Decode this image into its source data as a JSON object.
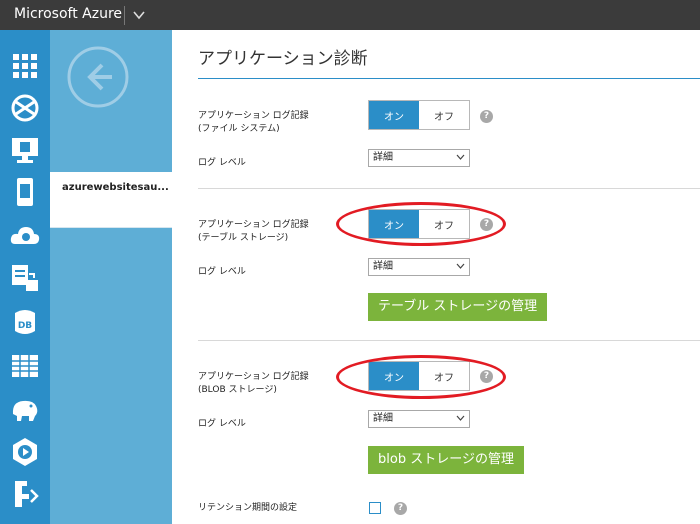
{
  "app": {
    "brand": "Microsoft Azure"
  },
  "rail": {
    "icons": [
      "grid-icon",
      "globe-icon",
      "monitor-icon",
      "mobile-icon",
      "cloud-gear-icon",
      "storage-transfer-icon",
      "database-icon",
      "table-icon",
      "hdinsight-elephant-icon",
      "media-icon",
      "deploy-icon"
    ]
  },
  "panel": {
    "site_name": "azurewebsitesau..."
  },
  "main": {
    "title": "アプリケーション診断",
    "sections": [
      {
        "log_label_1": "アプリケーション ログ記録",
        "log_label_2": "(ファイル システム)",
        "on": "オン",
        "off": "オフ",
        "level_label": "ログ レベル",
        "level_value": "詳細"
      },
      {
        "log_label_1": "アプリケーション ログ記録",
        "log_label_2": "(テーブル ストレージ)",
        "on": "オン",
        "off": "オフ",
        "level_label": "ログ レベル",
        "level_value": "詳細",
        "manage_button": "テーブル ストレージの管理"
      },
      {
        "log_label_1": "アプリケーション ログ記録",
        "log_label_2": "(BLOB ストレージ)",
        "on": "オン",
        "off": "オフ",
        "level_label": "ログ レベル",
        "level_value": "詳細",
        "manage_button": "blob ストレージの管理"
      }
    ],
    "retention_label": "リテンション期間の設定",
    "help_glyph": "?"
  },
  "colors": {
    "topbar": "#3b3b3b",
    "rail": "#2b8ec8",
    "panel": "#5eaed6",
    "accent": "#2b8ec8",
    "green": "#7cb43c",
    "highlight": "#e21b23"
  }
}
